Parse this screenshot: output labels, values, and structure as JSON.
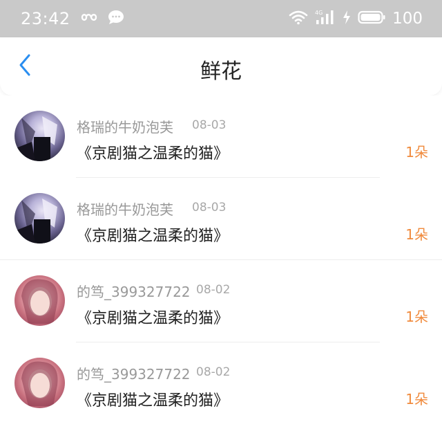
{
  "status_bar": {
    "time": "23:42",
    "battery": "100",
    "icons": [
      "infinity-icon",
      "message-bubble-icon",
      "wifi-icon",
      "signal-4g-icon",
      "charging-icon",
      "battery-icon"
    ]
  },
  "nav": {
    "title": "鲜花",
    "back_icon": "chevron-left-icon",
    "accent_color": "#2a8ef0"
  },
  "items": [
    {
      "username": "格瑞的牛奶泡芙",
      "date": "08-03",
      "title": "《京剧猫之温柔的猫》",
      "count": "1朵",
      "avatar": "anime-avatar"
    },
    {
      "username": "格瑞的牛奶泡芙",
      "date": "08-03",
      "title": "《京剧猫之温柔的猫》",
      "count": "1朵",
      "avatar": "anime-avatar"
    },
    {
      "username": "的笃_399327722",
      "date": "08-02",
      "title": "《京剧猫之温柔的猫》",
      "count": "1朵",
      "avatar": "photo-avatar"
    },
    {
      "username": "的笃_399327722",
      "date": "08-02",
      "title": "《京剧猫之温柔的猫》",
      "count": "1朵",
      "avatar": "photo-avatar"
    }
  ],
  "colors": {
    "status_bar_bg": "#c9c9c9",
    "count_orange": "#f08a3c",
    "meta_gray": "#999999"
  }
}
